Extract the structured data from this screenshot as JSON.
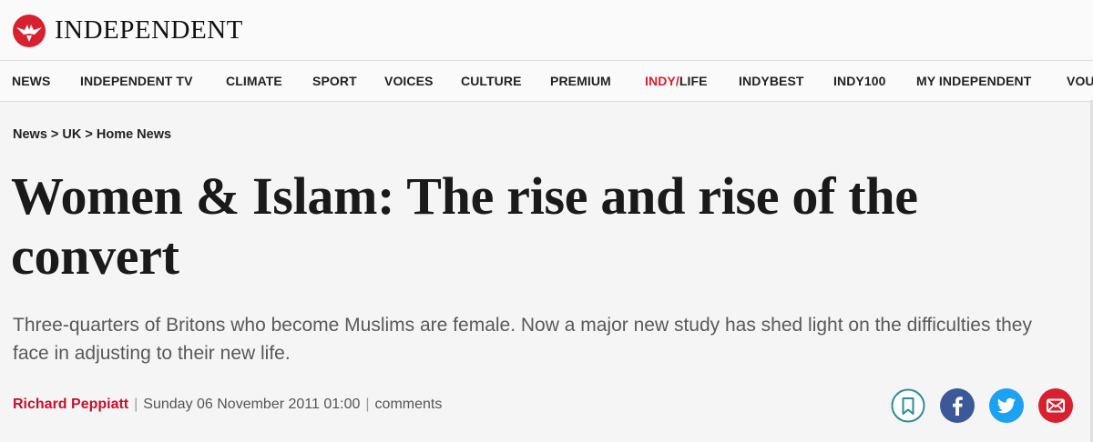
{
  "brand": {
    "name": "INDEPENDENT",
    "logo_icon": "eagle-icon",
    "accent_color": "#d8202f"
  },
  "nav": {
    "items": [
      {
        "label": "NEWS"
      },
      {
        "label": "INDEPENDENT TV"
      },
      {
        "label": "CLIMATE"
      },
      {
        "label": "SPORT"
      },
      {
        "label": "VOICES"
      },
      {
        "label": "CULTURE"
      },
      {
        "label": "PREMIUM"
      },
      {
        "label_accent": "INDY/",
        "label_rest": "LIFE"
      },
      {
        "label": "INDYBEST"
      },
      {
        "label": "INDY100"
      },
      {
        "label": "MY INDEPENDENT"
      },
      {
        "label": "VOU"
      }
    ]
  },
  "breadcrumb": {
    "text": "News > UK > Home News"
  },
  "article": {
    "headline": "Women & Islam: The rise and rise of the convert",
    "standfirst": "Three-quarters of Britons who become Muslims are female. Now a major new study has shed light on the difficulties they face in adjusting to their new life.",
    "author": "Richard Peppiatt",
    "date": "Sunday 06 November 2011 01:00",
    "comments_label": "comments"
  },
  "share": {
    "buttons": [
      {
        "icon": "bookmark-icon",
        "color": "#2e8a99"
      },
      {
        "icon": "facebook-icon",
        "color": "#3b5998"
      },
      {
        "icon": "twitter-icon",
        "color": "#1da1f2"
      },
      {
        "icon": "email-icon",
        "color": "#d8202f"
      }
    ]
  }
}
